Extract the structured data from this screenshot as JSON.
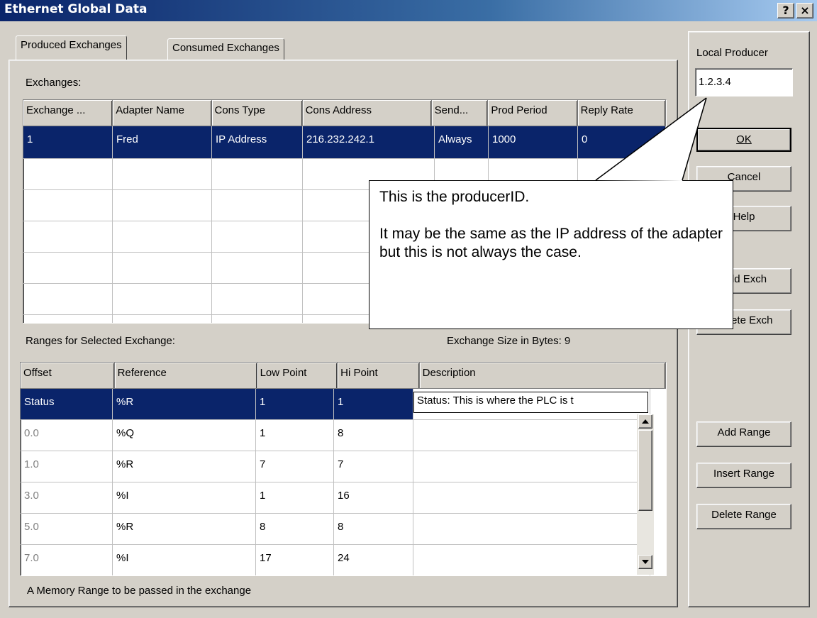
{
  "window": {
    "title": "Ethernet Global Data",
    "help_glyph": "?",
    "close_glyph": "×"
  },
  "tabs": [
    {
      "label": "Produced Exchanges",
      "active": true
    },
    {
      "label": "Consumed Exchanges",
      "active": false
    }
  ],
  "exchanges": {
    "label": "Exchanges:",
    "columns": [
      "Exchange ...",
      "Adapter Name",
      "Cons Type",
      "Cons Address",
      "Send...",
      "Prod Period",
      "Reply Rate"
    ],
    "rows": [
      [
        "1",
        "Fred",
        "IP Address",
        "216.232.242.1",
        "Always",
        "1000",
        "0"
      ]
    ]
  },
  "ranges": {
    "label": "Ranges for Selected Exchange:",
    "size_label": "Exchange Size in Bytes: 9",
    "columns": [
      "Offset",
      "Reference",
      "Low Point",
      "Hi Point",
      "Description"
    ],
    "rows": [
      [
        "Status",
        "%R",
        "1",
        "1",
        "Status: This is where the PLC is t"
      ],
      [
        "0.0",
        "%Q",
        "1",
        "8",
        ""
      ],
      [
        "1.0",
        "%R",
        "7",
        "7",
        ""
      ],
      [
        "3.0",
        "%I",
        "1",
        "16",
        ""
      ],
      [
        "5.0",
        "%R",
        "8",
        "8",
        ""
      ],
      [
        "7.0",
        "%I",
        "17",
        "24",
        ""
      ]
    ]
  },
  "status_text": "A Memory Range to be passed in the exchange",
  "local_producer": {
    "label": "Local Producer",
    "value": "1.2.3.4"
  },
  "buttons": {
    "ok": "OK",
    "cancel": "Cancel",
    "help": "Help",
    "add_exch": "Add Exch",
    "delete_exch": "Delete Exch",
    "add_range": "Add Range",
    "insert_range": "Insert Range",
    "delete_range": "Delete Range"
  },
  "callout": {
    "line1": "This is the producerID.",
    "line2": "It may be the same as the IP address of the adapter but this is not always the case."
  },
  "colors": {
    "titlebar": "#0a246a",
    "selection": "#0a246a",
    "face": "#d4d0c8"
  }
}
